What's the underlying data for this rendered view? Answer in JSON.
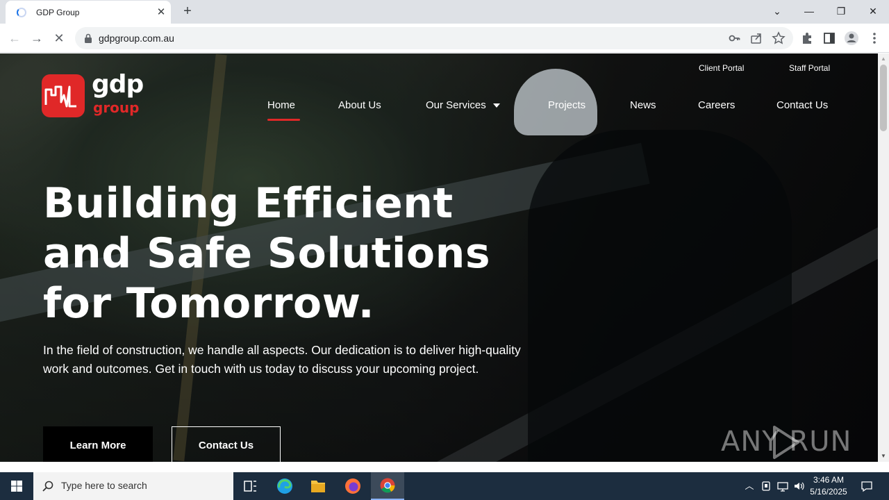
{
  "browser": {
    "tab_title": "GDP Group",
    "tab_close": "✕",
    "new_tab": "+",
    "url": "gdpgroup.com.au",
    "window_controls": {
      "list": "⌄",
      "minimize": "—",
      "restore": "❐",
      "close": "✕"
    },
    "nav_glyphs": {
      "back": "←",
      "forward": "→",
      "stop": "✕"
    },
    "icons": [
      "key-icon",
      "share-icon",
      "star-icon",
      "extensions-icon",
      "side-panel-icon",
      "profile-icon",
      "menu-icon"
    ]
  },
  "site": {
    "logo": {
      "word": "gdp",
      "sub": "group"
    },
    "util_links": {
      "client_portal": "Client Portal",
      "staff_portal": "Staff Portal"
    },
    "nav": {
      "home": "Home",
      "about": "About Us",
      "services": "Our Services",
      "projects": "Projects",
      "news": "News",
      "careers": "Careers",
      "contact": "Contact Us"
    },
    "hero": {
      "title_line1": "Building Efficient",
      "title_line2": "and Safe Solutions",
      "title_line3": "for Tomorrow.",
      "text": "In the field of construction, we handle all aspects. Our dedication is to deliver high-quality work and outcomes. Get in touch with us today to discuss your upcoming project.",
      "btn_primary": "Learn More",
      "btn_secondary": "Contact Us"
    },
    "watermark": "ANY   RUN",
    "accent_color": "#e02828"
  },
  "taskbar": {
    "search_placeholder": "Type here to search",
    "time": "3:46 AM",
    "date": "5/16/2025"
  }
}
